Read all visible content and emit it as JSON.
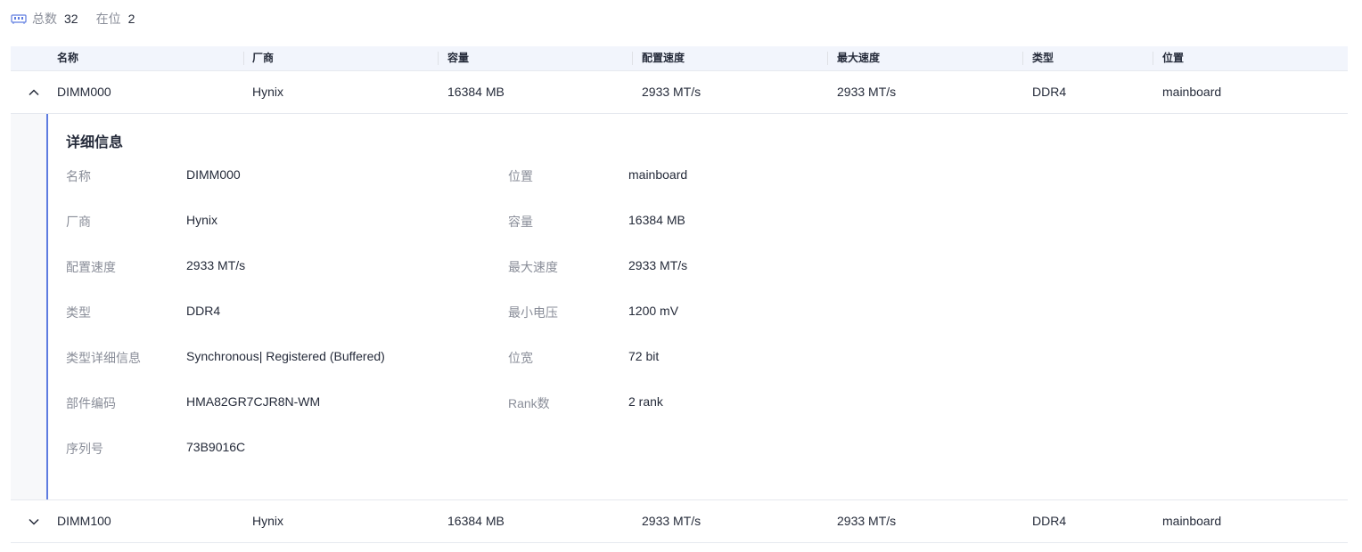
{
  "summary": {
    "icon": "memory-icon",
    "total_label": "总数",
    "total_value": "32",
    "present_label": "在位",
    "present_value": "2"
  },
  "table": {
    "columns": [
      "名称",
      "厂商",
      "容量",
      "配置速度",
      "最大速度",
      "类型",
      "位置"
    ],
    "rows": [
      {
        "expanded": true,
        "name": "DIMM000",
        "vendor": "Hynix",
        "capacity": "16384 MB",
        "config_speed": "2933 MT/s",
        "max_speed": "2933 MT/s",
        "type": "DDR4",
        "location": "mainboard"
      },
      {
        "expanded": false,
        "name": "DIMM100",
        "vendor": "Hynix",
        "capacity": "16384 MB",
        "config_speed": "2933 MT/s",
        "max_speed": "2933 MT/s",
        "type": "DDR4",
        "location": "mainboard"
      }
    ]
  },
  "detail": {
    "title": "详细信息",
    "left": [
      {
        "label": "名称",
        "value": "DIMM000"
      },
      {
        "label": "厂商",
        "value": "Hynix"
      },
      {
        "label": "配置速度",
        "value": "2933 MT/s"
      },
      {
        "label": "类型",
        "value": "DDR4"
      },
      {
        "label": "类型详细信息",
        "value": "Synchronous| Registered (Buffered)"
      },
      {
        "label": "部件编码",
        "value": "HMA82GR7CJR8N-WM"
      },
      {
        "label": "序列号",
        "value": "73B9016C"
      }
    ],
    "right": [
      {
        "label": "位置",
        "value": "mainboard"
      },
      {
        "label": "容量",
        "value": "16384 MB"
      },
      {
        "label": "最大速度",
        "value": "2933 MT/s"
      },
      {
        "label": "最小电压",
        "value": "1200 mV"
      },
      {
        "label": "位宽",
        "value": "72 bit"
      },
      {
        "label": "Rank数",
        "value": "2 rank"
      }
    ]
  },
  "colors": {
    "accent": "#5e7ce0",
    "header_bg": "#f2f5fc",
    "label_gray": "#8a8e99",
    "text": "#252b3a"
  }
}
